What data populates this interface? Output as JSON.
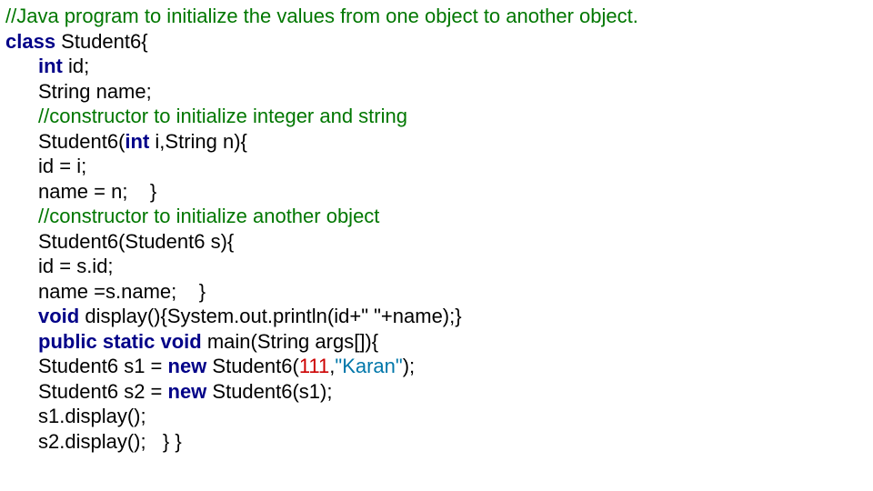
{
  "code": {
    "l1_comment": "//Java program to initialize the values from one object to another object.",
    "l2_kw1": "class",
    "l2_rest": " Student6{",
    "l3_kw": "int",
    "l3_rest": " id;",
    "l4": "String name;",
    "l5_comment": "//constructor to initialize integer and string",
    "l6_a": "Student6(",
    "l6_kw": "int",
    "l6_b": " i,String n){",
    "l7": "id = i;",
    "l8": "name = n;    }",
    "l9_comment": "//constructor to initialize another object",
    "l10": "Student6(Student6 s){",
    "l11": "id = s.id;",
    "l12": "name =s.name;    }",
    "l13_kw": "void",
    "l13_rest": " display(){System.out.println(id+\" \"+name);}",
    "l14_kw": "public static void",
    "l14_rest": " main(String args[]){",
    "l15_a": "Student6 s1 = ",
    "l15_kw": "new",
    "l15_b": " Student6(",
    "l15_num": "111",
    "l15_c": ",",
    "l15_str": "\"Karan\"",
    "l15_d": ");",
    "l16_a": "Student6 s2 = ",
    "l16_kw": "new",
    "l16_b": " Student6(s1);",
    "l17": "s1.display();",
    "l18": "s2.display();   } }"
  }
}
